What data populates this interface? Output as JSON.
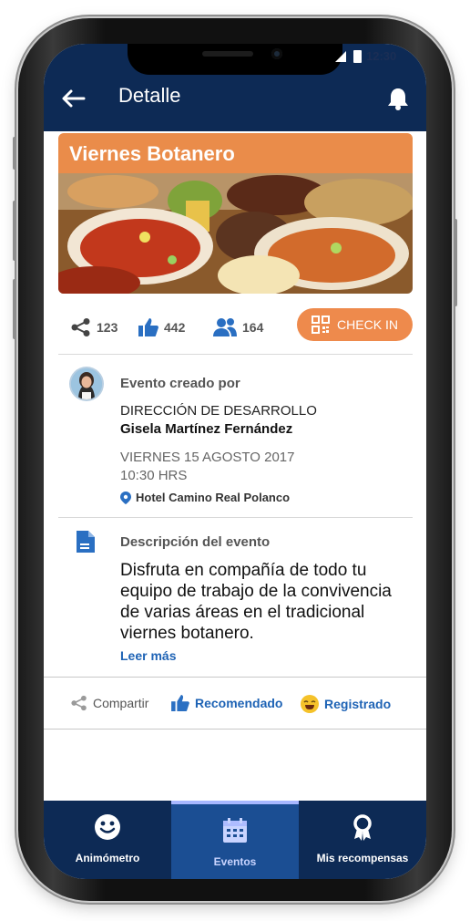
{
  "status": {
    "time": "12:30"
  },
  "header": {
    "title": "Detalle"
  },
  "event": {
    "title": "Viernes Botanero",
    "shares": "123",
    "likes": "442",
    "attendees": "164",
    "checkin_label": "CHECK IN",
    "created_by_label": "Evento creado por",
    "department": "DIRECCIÓN DE DESARROLLO",
    "creator": "Gisela Martínez Fernández",
    "date": "VIERNES 15 AGOSTO 2017",
    "time": "10:30 HRS",
    "location": "Hotel Camino Real Polanco",
    "description_label": "Descripción del evento",
    "description": "Disfruta en compañía de todo tu equipo de trabajo de la convivencia de varias áreas en el tradicional viernes botanero.",
    "read_more": "Leer más"
  },
  "actions": {
    "share": "Compartir",
    "recommended": "Recomendado",
    "registered": "Registrado"
  },
  "tabs": [
    {
      "label": "Animómetro",
      "icon": "smiley-icon"
    },
    {
      "label": "Eventos",
      "icon": "calendar-icon"
    },
    {
      "label": "Mis recompensas",
      "icon": "award-ribbon-icon"
    }
  ],
  "colors": {
    "navy": "#0d2a55",
    "orange": "#ea8c4a",
    "blue": "#1e63b5",
    "active_tab": "#1b4e93"
  }
}
